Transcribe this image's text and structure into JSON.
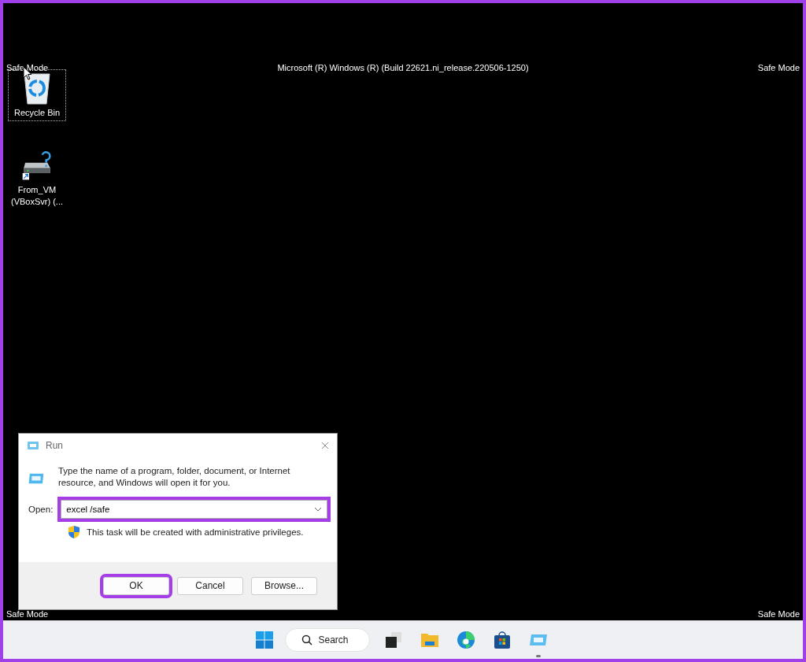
{
  "desktop": {
    "build_text": "Microsoft (R) Windows (R) (Build 22621.ni_release.220506-1250)",
    "corner_labels": [
      "Safe Mode",
      "Safe Mode",
      "Safe Mode",
      "Safe Mode"
    ],
    "icons": [
      {
        "kind": "recycle",
        "label": "Recycle Bin",
        "selected": true
      },
      {
        "kind": "drive",
        "label": "From_VM (VBoxSvr) (...",
        "selected": false
      }
    ]
  },
  "run_dialog": {
    "title": "Run",
    "description": "Type the name of a program, folder, document, or Internet resource, and Windows will open it for you.",
    "open_label": "Open:",
    "open_value": "excel /safe",
    "open_highlighted": true,
    "admin_note": "This task will be created with administrative privileges.",
    "buttons": [
      {
        "label": "OK",
        "highlighted": true
      },
      {
        "label": "Cancel",
        "highlighted": false
      },
      {
        "label": "Browse...",
        "highlighted": false
      }
    ]
  },
  "taskbar": {
    "search_label": "Search",
    "apps": [
      {
        "kind": "taskview",
        "running": false
      },
      {
        "kind": "explorer",
        "running": false
      },
      {
        "kind": "edge",
        "running": false
      },
      {
        "kind": "store",
        "running": false
      },
      {
        "kind": "run",
        "running": true
      }
    ]
  }
}
